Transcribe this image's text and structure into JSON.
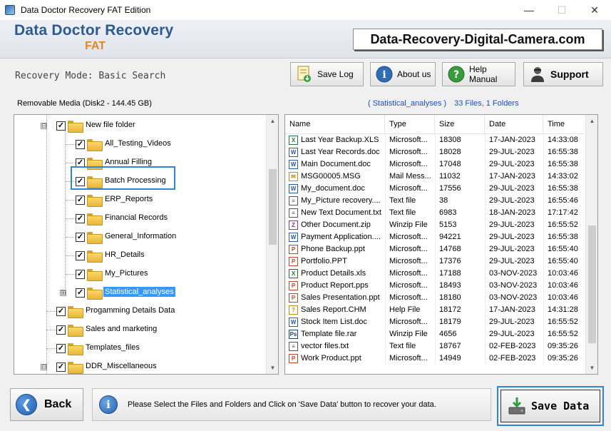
{
  "window": {
    "title": "Data Doctor Recovery FAT Edition",
    "minimize": "—",
    "maximize": "☐",
    "close": "✕"
  },
  "header": {
    "brand": "Data Doctor Recovery",
    "edition": "FAT",
    "site": "Data-Recovery-Digital-Camera.com"
  },
  "toolbar": {
    "mode": "Recovery Mode: Basic Search",
    "save_log": "Save Log",
    "about_us": "About us",
    "help_manual": "Help Manual",
    "support": "Support"
  },
  "left_panel": {
    "heading": "Removable Media (Disk2 - 144.45 GB)",
    "tree": [
      {
        "label": "New file folder",
        "checked": true,
        "expander": "⊟"
      },
      {
        "label": "All_Testing_Videos",
        "checked": true
      },
      {
        "label": "Annual Filling",
        "checked": true
      },
      {
        "label": "Batch Processing",
        "checked": true
      },
      {
        "label": "ERP_Reports",
        "checked": true
      },
      {
        "label": "Financial Records",
        "checked": true
      },
      {
        "label": "General_Information",
        "checked": true
      },
      {
        "label": "HR_Details",
        "checked": true
      },
      {
        "label": "My_Pictures",
        "checked": true
      },
      {
        "label": "Statistical_analyses",
        "checked": true,
        "selected": true,
        "expander": "⊞"
      },
      {
        "label": "Progamming Details Data",
        "checked": true
      },
      {
        "label": "Sales and marketing",
        "checked": true
      },
      {
        "label": "Templates_files",
        "checked": true
      },
      {
        "label": "DDR_Miscellaneous",
        "checked": true,
        "expander": "⊟"
      }
    ]
  },
  "right_panel": {
    "folder": "( Statistical_analyses )",
    "count": "33 Files, 1 Folders",
    "columns": [
      "Name",
      "Type",
      "Size",
      "Date",
      "Time"
    ],
    "rows": [
      {
        "name": "Last Year Backup.XLS",
        "type": "Microsoft...",
        "size": "18308",
        "date": "17-JAN-2023",
        "time": "14:33:08",
        "icon": "X",
        "color": "#1d7a3c"
      },
      {
        "name": "Last Year Records.doc",
        "type": "Microsoft...",
        "size": "18028",
        "date": "29-JUL-2023",
        "time": "16:55:38",
        "icon": "W",
        "color": "#2b5aa8"
      },
      {
        "name": "Main Document.doc",
        "type": "Microsoft...",
        "size": "17048",
        "date": "29-JUL-2023",
        "time": "16:55:38",
        "icon": "W",
        "color": "#2b5aa8"
      },
      {
        "name": "MSG00005.MSG",
        "type": "Mail Mess...",
        "size": "11032",
        "date": "17-JAN-2023",
        "time": "14:33:02",
        "icon": "✉",
        "color": "#c98a14"
      },
      {
        "name": "My_document.doc",
        "type": "Microsoft...",
        "size": "17556",
        "date": "29-JUL-2023",
        "time": "16:55:38",
        "icon": "W",
        "color": "#2b5aa8"
      },
      {
        "name": "My_Picture recovery....",
        "type": "Text file",
        "size": "38",
        "date": "29-JUL-2023",
        "time": "16:55:46",
        "icon": "≡",
        "color": "#555555"
      },
      {
        "name": "New Text Document.txt",
        "type": "Text file",
        "size": "6983",
        "date": "18-JAN-2023",
        "time": "17:17:42",
        "icon": "≡",
        "color": "#555555"
      },
      {
        "name": "Other Document.zip",
        "type": "Winzip File",
        "size": "5153",
        "date": "29-JUL-2023",
        "time": "16:55:52",
        "icon": "Z",
        "color": "#8e2f9c"
      },
      {
        "name": "Payment Application....",
        "type": "Microsoft...",
        "size": "94221",
        "date": "29-JUL-2023",
        "time": "16:55:38",
        "icon": "W",
        "color": "#2b5aa8"
      },
      {
        "name": "Phone Backup.ppt",
        "type": "Microsoft...",
        "size": "14768",
        "date": "29-JUL-2023",
        "time": "16:55:40",
        "icon": "P",
        "color": "#c8432b"
      },
      {
        "name": "Portfolio.PPT",
        "type": "Microsoft...",
        "size": "17376",
        "date": "29-JUL-2023",
        "time": "16:55:40",
        "icon": "P",
        "color": "#c8432b"
      },
      {
        "name": "Product Details.xls",
        "type": "Microsoft...",
        "size": "17188",
        "date": "03-NOV-2023",
        "time": "10:03:46",
        "icon": "X",
        "color": "#1d7a3c"
      },
      {
        "name": "Product Report.pps",
        "type": "Microsoft...",
        "size": "18493",
        "date": "03-NOV-2023",
        "time": "10:03:46",
        "icon": "P",
        "color": "#c8432b"
      },
      {
        "name": "Sales Presentation.ppt",
        "type": "Microsoft...",
        "size": "18180",
        "date": "03-NOV-2023",
        "time": "10:03:46",
        "icon": "P",
        "color": "#c8432b"
      },
      {
        "name": "Sales Report.CHM",
        "type": "Help File",
        "size": "18172",
        "date": "17-JAN-2023",
        "time": "14:31:28",
        "icon": "?",
        "color": "#c98a14"
      },
      {
        "name": "Stock Item List.doc",
        "type": "Microsoft...",
        "size": "18179",
        "date": "29-JUL-2023",
        "time": "16:55:52",
        "icon": "W",
        "color": "#2b5aa8"
      },
      {
        "name": "Template file.rar",
        "type": "Winzip File",
        "size": "4656",
        "date": "29-JUL-2023",
        "time": "16:55:52",
        "icon": "Ps",
        "color": "#1c3f7a"
      },
      {
        "name": "vector files.txt",
        "type": "Text file",
        "size": "18767",
        "date": "02-FEB-2023",
        "time": "09:35:26",
        "icon": "≡",
        "color": "#555555"
      },
      {
        "name": "Work Product.ppt",
        "type": "Microsoft...",
        "size": "14949",
        "date": "02-FEB-2023",
        "time": "09:35:26",
        "icon": "P",
        "color": "#c8432b"
      }
    ]
  },
  "bottom": {
    "back": "Back",
    "info": "Please Select the Files and Folders and Click on 'Save Data' button to recover your data.",
    "save": "Save Data"
  },
  "colors": {
    "brand": "#2c5a93",
    "edition": "#e48621",
    "selection": "#3399ff",
    "focus_border": "#2f86d6",
    "link": "#1a4fc4"
  }
}
